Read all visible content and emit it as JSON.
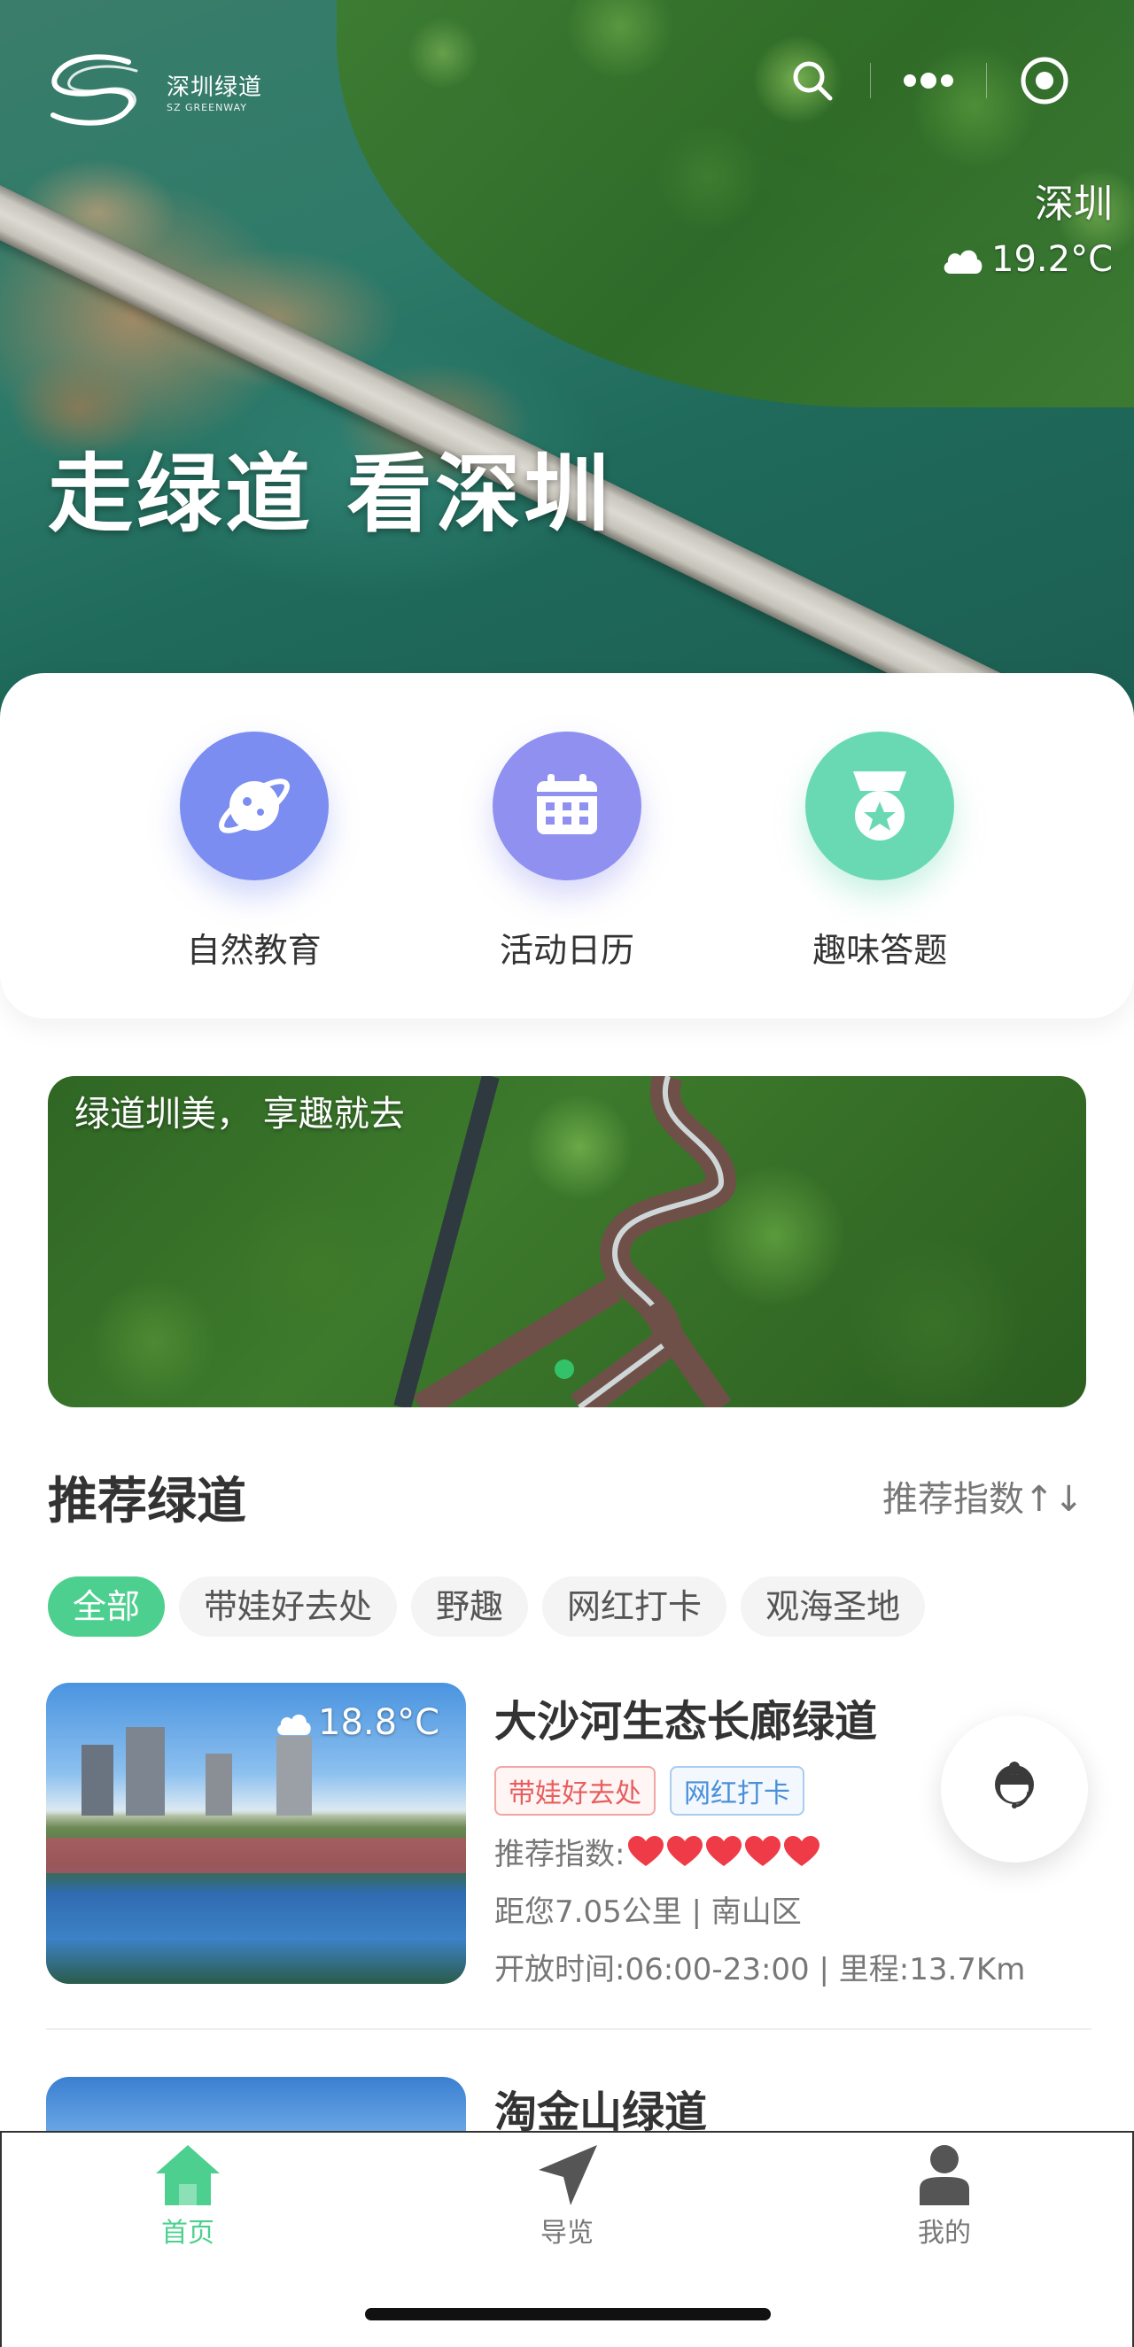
{
  "header": {
    "logo_cn": "深圳绿道",
    "logo_en": "SZ GREENWAY",
    "capsule": [
      "search-icon",
      "more-icon",
      "target-icon"
    ],
    "city": "深圳",
    "temperature": "19.2°C",
    "hero_title": "走绿道 看深圳"
  },
  "entries": [
    {
      "label": "自然教育",
      "icon": "planet-icon",
      "color": "#7b8df0"
    },
    {
      "label": "活动日历",
      "icon": "calendar-icon",
      "color": "#8f90f0"
    },
    {
      "label": "趣味答题",
      "icon": "medal-icon",
      "color": "#69d9b3"
    }
  ],
  "banner": {
    "text": "绿道圳美， 享趣就去"
  },
  "section": {
    "title": "推荐绿道",
    "sort": "推荐指数↑↓"
  },
  "filters": {
    "active": "全部",
    "items": [
      "全部",
      "带娃好去处",
      "野趣",
      "网红打卡",
      "观海圣地"
    ]
  },
  "greenways": [
    {
      "name": "大沙河生态长廊绿道",
      "weather": "18.8°C",
      "tags": [
        "带娃好去处",
        "网红打卡"
      ],
      "rating_label": "推荐指数:",
      "rating": 5,
      "distance": "距您7.05公里 | 南山区",
      "hours": "开放时间:06:00-23:00 | 里程:13.7Km"
    },
    {
      "name": "淘金山绿道"
    }
  ],
  "tabbar": {
    "active": "首页",
    "items": [
      {
        "label": "首页",
        "icon": "home-icon"
      },
      {
        "label": "导览",
        "icon": "navigate-icon"
      },
      {
        "label": "我的",
        "icon": "user-icon"
      }
    ]
  },
  "colors": {
    "accent": "#4dd08f",
    "heart": "#ef3b47"
  }
}
